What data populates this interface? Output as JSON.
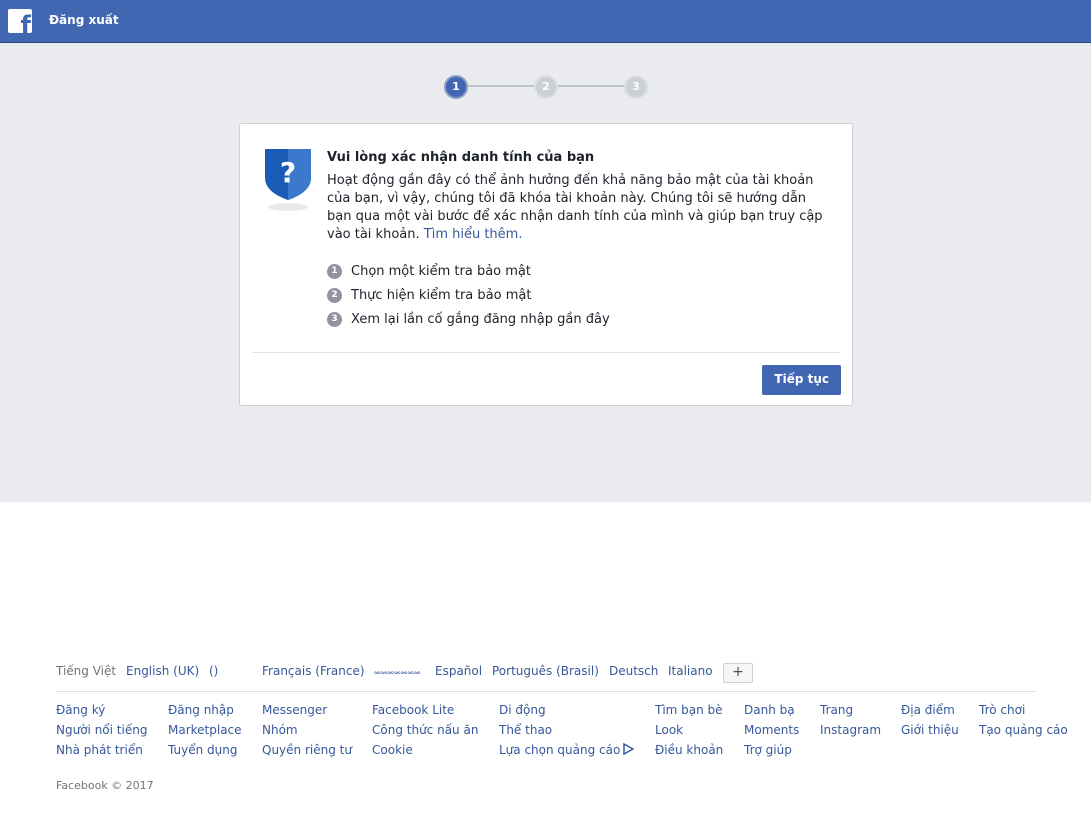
{
  "header": {
    "logout_label": "Đăng xuất"
  },
  "stepper": {
    "steps": [
      "1",
      "2",
      "3"
    ],
    "active_step": 1
  },
  "card": {
    "title": "Vui lòng xác nhận danh tính của bạn",
    "description": "Hoạt động gần đây có thể ảnh hưởng đến khả năng bảo mật của tài khoản của bạn, vì vậy, chúng tôi đã khóa tài khoản này. Chúng tôi sẽ hướng dẫn bạn qua một vài bước để xác nhận danh tính của mình và giúp bạn truy cập vào tài khoản.",
    "learn_more": "Tìm hiểu thêm.",
    "steps": [
      {
        "num": "1",
        "label": "Chọn một kiểm tra bảo mật"
      },
      {
        "num": "2",
        "label": "Thực hiện kiểm tra bảo mật"
      },
      {
        "num": "3",
        "label": "Xem lại lần cố gắng đăng nhập gần đây"
      }
    ],
    "continue_label": "Tiếp tục"
  },
  "footer": {
    "languages": {
      "current": "Tiếng Việt",
      "others": [
        "English (UK)",
        "()",
        "Français (France)",
        "𝆘𝆘𝆘𝆘𝆘𝆘𝆘",
        "Español",
        "Português (Brasil)",
        "Deutsch",
        "Italiano"
      ],
      "more": "+"
    },
    "link_columns": [
      [
        "Đăng ký",
        "Người nổi tiếng",
        "Nhà phát triển"
      ],
      [
        "Đăng nhập",
        "Marketplace",
        "Tuyển dụng"
      ],
      [
        "Messenger",
        "Nhóm",
        "Quyền riêng tư"
      ],
      [
        "Facebook Lite",
        "Công thức nấu ăn",
        "Cookie"
      ],
      [
        "Di động",
        "Thể thao",
        "Lựa chọn quảng cáo"
      ],
      [
        "Tìm bạn bè",
        "Look",
        "Điều khoản"
      ],
      [
        "Danh bạ",
        "Moments",
        "Trợ giúp"
      ],
      [
        "Trang",
        "Instagram"
      ],
      [
        "Địa điểm",
        "Giới thiệu"
      ],
      [
        "Trò chơi",
        "Tạo quảng cáo"
      ]
    ],
    "copyright": "Facebook © 2017"
  }
}
